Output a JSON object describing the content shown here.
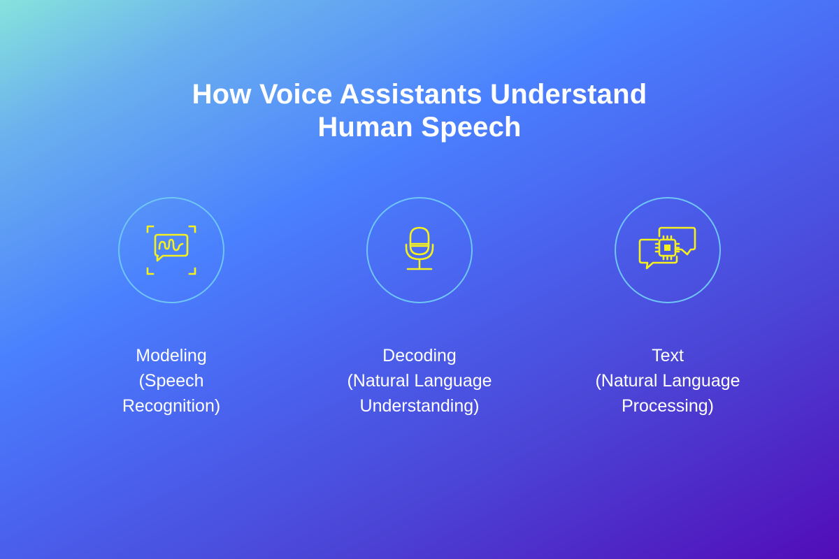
{
  "title": {
    "line1": "How Voice Assistants Understand",
    "line2": "Human Speech"
  },
  "colors": {
    "icon_stroke": "#f6f11c",
    "circle_stroke": "#6fc6f4",
    "text": "#ffffff",
    "gradient_start": "#86e3dc",
    "gradient_mid": "#4a80fe",
    "gradient_end": "#520cb8"
  },
  "steps": [
    {
      "icon": "speech-recognition-icon",
      "label_lines": [
        "Modeling",
        "(Speech",
        "Recognition)"
      ]
    },
    {
      "icon": "microphone-icon",
      "label_lines": [
        "Decoding",
        "(Natural Language",
        "Understanding)"
      ]
    },
    {
      "icon": "chat-processor-icon",
      "label_lines": [
        "Text",
        "(Natural Language",
        "Processing)"
      ]
    }
  ]
}
